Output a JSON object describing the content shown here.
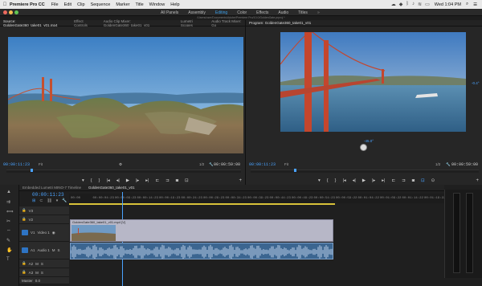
{
  "menubar": {
    "apple_icon": "apple-icon",
    "app_name": "Premiere Pro CC",
    "items": [
      "File",
      "Edit",
      "Clip",
      "Sequence",
      "Marker",
      "Title",
      "Window",
      "Help"
    ],
    "clock": "Wed 1:04 PM"
  },
  "workspaces": {
    "tabs": [
      "All Panels",
      "Assembly",
      "Editing",
      "Color",
      "Effects",
      "Audio",
      "Titles"
    ],
    "active": "Editing",
    "more": "»"
  },
  "project_path": "/Users/user/Documents/Adobe/Premiere Pro/10.0/GoldenGate.prproj *",
  "source_monitor": {
    "tabs": [
      "Source: GoldenGate360_take01_v01.mp4",
      "Effect Controls",
      "Audio Clip Mixer: GoldenGate360_take01_v01",
      "Lumetri Scopes",
      "Audio Track Mixer: Go"
    ],
    "timecode": "00:00:11:23",
    "fit": "Fit",
    "resolution": "1/2",
    "duration": "00:00:59:00"
  },
  "program_monitor": {
    "tab": "Program: GoldenGate360_take01_v01",
    "timecode": "00:00:11:23",
    "fit": "Fit",
    "resolution": "1/2",
    "duration": "00:00:59:00",
    "pitch_right": "-0.4°",
    "pitch_bottom": "-45.0°"
  },
  "timeline": {
    "tabs": [
      "Embedded Lumetri MINO-7 Timeline",
      "GoldenGate360_take01_v01"
    ],
    "timecode": "00:00:11:23",
    "ruler_labels": [
      "00:00",
      "00:00:04:23",
      "00:00:09:23",
      "00:00:14:23",
      "00:00:19:23",
      "00:00:24:23",
      "00:00:29:23",
      "00:00:34:23",
      "00:00:39:23",
      "00:00:44:23",
      "00:00:49:23",
      "00:00:54:23",
      "00:00:59:22",
      "00:01:04:22",
      "00:01:09:22",
      "00:01:14:22",
      "00:01:19:22",
      "00:01:24:22"
    ],
    "tracks": {
      "v3": "V3",
      "v2": "V2",
      "v1": "V1",
      "v1_name": "Video 1",
      "a1": "A1",
      "a1_name": "Audio 1",
      "a2": "A2",
      "a3": "A3",
      "master": "Master",
      "master_value": "0.0"
    },
    "video_clip": "GoldenGate360_take01_v01.mp4 [V]"
  },
  "colors": {
    "accent": "#3a9ee8",
    "timecode": "#4aa3ff",
    "panel": "#232323",
    "clip_audio": "#3b6590"
  }
}
